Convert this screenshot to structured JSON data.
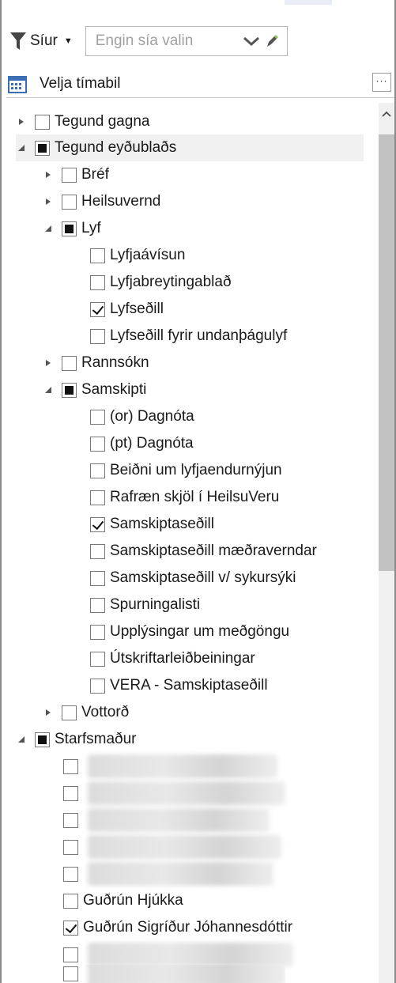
{
  "filter": {
    "label": "Síur",
    "placeholder": "Engin sía valin"
  },
  "period": {
    "label": "Velja tímabil",
    "more": "···"
  },
  "tree": {
    "tegund_gagna": "Tegund gagna",
    "tegund_eydublads": "Tegund eyðublaðs",
    "bref": "Bréf",
    "heilsuvernd": "Heilsuvernd",
    "lyf": "Lyf",
    "lyfjaavisun": "Lyfjaávísun",
    "lyfjabreytingablad": "Lyfjabreytingablað",
    "lyfsedill": "Lyfseðill",
    "lyfsedill_undanthagulyf": "Lyfseðill fyrir undanþágulyf",
    "rannsokn": "Rannsókn",
    "samskipti": "Samskipti",
    "or_dagnota": "(or) Dagnóta",
    "pt_dagnota": "(pt) Dagnóta",
    "beidni": "Beiðni um lyfjaendurnýjun",
    "rafraen_skjol": "Rafræn skjöl í HeilsuVeru",
    "samskiptasedill": "Samskiptaseðill",
    "samskiptasedill_maedravernd": "Samskiptaseðill mæðraverndar",
    "samskiptasedill_sykursyki": "Samskiptaseðill v/ sykursýki",
    "spurningalisti": "Spurningalisti",
    "upplysingar_medgongu": "Upplýsingar um meðgöngu",
    "utskriftarleidbeiningar": "Útskriftarleiðbeiningar",
    "vera_samskiptasedill": "VERA - Samskiptaseðill",
    "vottord": "Vottorð",
    "starfsmadur": "Starfsmaður",
    "gudrun_hjukka": "Guðrún Hjúkka",
    "gudrun_sigridur": "Guðrún Sigríður Jóhannesdóttir"
  }
}
